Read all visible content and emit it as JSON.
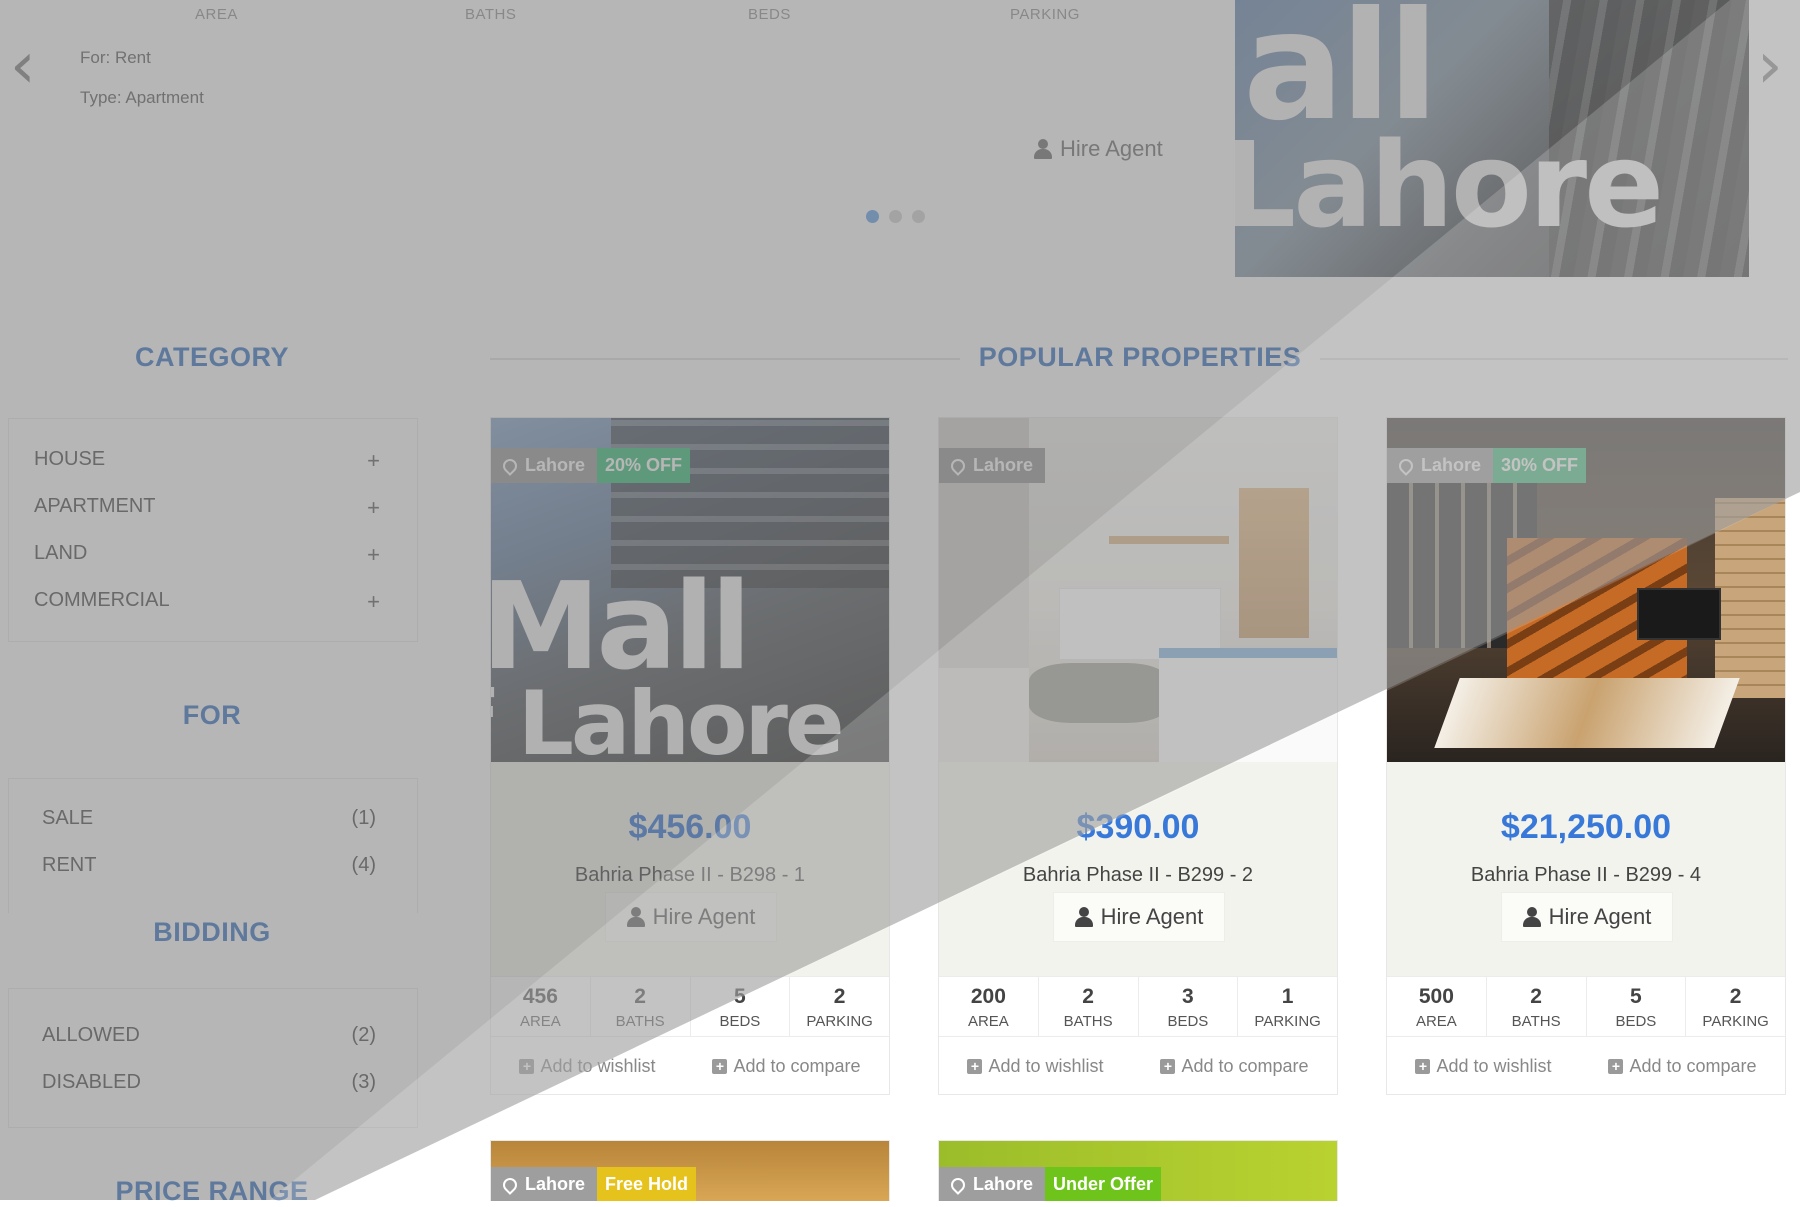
{
  "slider": {
    "spec_headers": [
      "AREA",
      "BATHS",
      "BEDS",
      "PARKING"
    ],
    "for_line": "For: Rent",
    "type_line": "Type: Apartment",
    "hire_label": "Hire Agent",
    "slide_text_1": "all",
    "slide_text_2": "Lahore",
    "prev_icon": "‹",
    "next_icon": "›"
  },
  "sidebar": {
    "category_title": "CATEGORY",
    "categories": [
      {
        "label": "HOUSE",
        "icon": "+"
      },
      {
        "label": "APARTMENT",
        "icon": "+"
      },
      {
        "label": "LAND",
        "icon": "+"
      },
      {
        "label": "COMMERCIAL",
        "icon": "+"
      }
    ],
    "for_title": "FOR",
    "for_items": [
      {
        "label": "SALE",
        "count": "(1)"
      },
      {
        "label": "RENT",
        "count": "(4)"
      }
    ],
    "bidding_title": "BIDDING",
    "bidding_items": [
      {
        "label": "ALLOWED",
        "count": "(2)"
      },
      {
        "label": "DISABLED",
        "count": "(3)"
      }
    ],
    "price_title": "PRICE RANGE"
  },
  "main": {
    "popular_title": "POPULAR PROPERTIES",
    "cards": [
      {
        "location": "Lahore",
        "badge": "20% OFF",
        "badge_color": "#3fbf7f",
        "price": "$456.00",
        "name": "Bahria Phase II - B298 - 1",
        "hire": "Hire Agent",
        "img_text_1": "Mall",
        "img_text_2": "f Lahore",
        "specs": [
          {
            "n": "456",
            "l": "AREA"
          },
          {
            "n": "2",
            "l": "BATHS"
          },
          {
            "n": "5",
            "l": "BEDS"
          },
          {
            "n": "2",
            "l": "PARKING"
          }
        ],
        "wishlist": "Add to wishlist",
        "compare": "Add to compare"
      },
      {
        "location": "Lahore",
        "badge": "",
        "badge_color": "",
        "price": "$390.00",
        "name": "Bahria Phase II - B299 - 2",
        "hire": "Hire Agent",
        "specs": [
          {
            "n": "200",
            "l": "AREA"
          },
          {
            "n": "2",
            "l": "BATHS"
          },
          {
            "n": "3",
            "l": "BEDS"
          },
          {
            "n": "1",
            "l": "PARKING"
          }
        ],
        "wishlist": "Add to wishlist",
        "compare": "Add to compare"
      },
      {
        "location": "Lahore",
        "badge": "30% OFF",
        "badge_color": "#3fbf7f",
        "price": "$21,250.00",
        "name": "Bahria Phase II - B299 - 4",
        "hire": "Hire Agent",
        "specs": [
          {
            "n": "500",
            "l": "AREA"
          },
          {
            "n": "2",
            "l": "BATHS"
          },
          {
            "n": "5",
            "l": "BEDS"
          },
          {
            "n": "2",
            "l": "PARKING"
          }
        ],
        "wishlist": "Add to wishlist",
        "compare": "Add to compare"
      }
    ],
    "bottom_cards": [
      {
        "location": "Lahore",
        "badge": "Free Hold",
        "badge_color": "#e6c21c"
      },
      {
        "location": "Lahore",
        "badge": "Under Offer",
        "badge_color": "#6fc41c"
      }
    ]
  },
  "colors": {
    "accent": "#3f78c8",
    "price": "#3778d8",
    "overlay": "#808080"
  },
  "icons": {
    "user": "user-icon",
    "pin": "map-marker-icon",
    "plus_square": "plus-square-icon",
    "arrows": [
      "chevron-left-icon",
      "chevron-right-icon"
    ]
  }
}
